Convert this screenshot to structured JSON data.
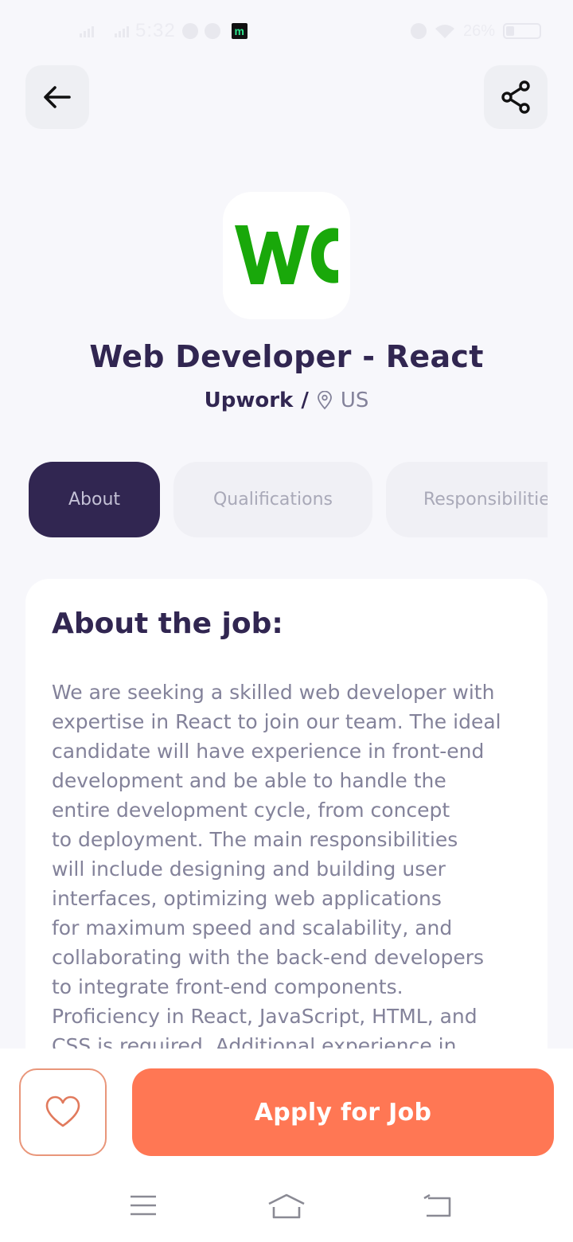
{
  "status_bar": {
    "time": "5:32",
    "battery": "26%"
  },
  "header": {
    "back_icon": "arrow-left-icon",
    "share_icon": "share-icon"
  },
  "job": {
    "logo_text": "WC",
    "logo_color": "#19A80A",
    "title": "Web Developer - React",
    "company": "Upwork",
    "separator": "/",
    "location": "US"
  },
  "tabs": [
    {
      "label": "About",
      "active": true
    },
    {
      "label": "Qualifications",
      "active": false
    },
    {
      "label": "Responsibilities",
      "active": false
    }
  ],
  "about": {
    "heading": "About the job:",
    "lines": [
      "We are seeking a skilled web developer with",
      "expertise in React to join our team. The ideal",
      "candidate will have experience in front-end",
      "development and be able to handle the",
      "entire development cycle, from concept",
      "to deployment. The main responsibilities",
      "will include designing and building user",
      "interfaces, optimizing web applications",
      "for maximum speed and scalability, and",
      "collaborating with the back-end developers",
      "to integrate front-end components.",
      "Proficiency in React, JavaScript, HTML, and",
      "CSS is required. Additional experience in"
    ]
  },
  "footer": {
    "favorite_icon": "heart-icon",
    "apply_label": "Apply for Job"
  },
  "colors": {
    "primary": "#312651",
    "accent": "#FF7754",
    "gray": "#83829A",
    "background": "#F7F7FB"
  }
}
